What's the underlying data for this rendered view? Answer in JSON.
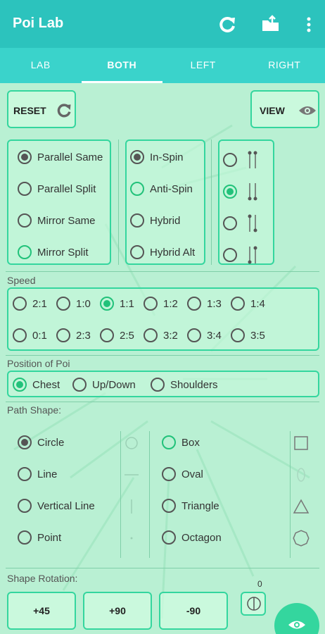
{
  "app": {
    "title": "Poi Lab"
  },
  "toolbar_icons": [
    "refresh-icon",
    "open-folder-icon",
    "more-vert-icon"
  ],
  "tabs": [
    {
      "label": "LAB",
      "active": false
    },
    {
      "label": "BOTH",
      "active": true
    },
    {
      "label": "LEFT",
      "active": false
    },
    {
      "label": "RIGHT",
      "active": false
    }
  ],
  "buttons": {
    "reset": "RESET",
    "view": "VIEW"
  },
  "hand_mode": {
    "options": [
      "Parallel Same",
      "Parallel Split",
      "Mirror Same",
      "Mirror Split"
    ],
    "selected": "Parallel Same"
  },
  "spin_mode": {
    "options": [
      "In-Spin",
      "Anti-Spin",
      "Hybrid",
      "Hybrid Alt"
    ],
    "selected": "In-Spin"
  },
  "orientation": {
    "selected_index": 1
  },
  "speed": {
    "label": "Speed",
    "row1": [
      "2:1",
      "1:0",
      "1:1",
      "1:2",
      "1:3",
      "1:4"
    ],
    "row2": [
      "0:1",
      "2:3",
      "2:5",
      "3:2",
      "3:4",
      "3:5"
    ],
    "selected": "1:1"
  },
  "position": {
    "label": "Position of Poi",
    "options": [
      "Chest",
      "Up/Down",
      "Shoulders"
    ],
    "selected": "Chest"
  },
  "path_shape": {
    "label": "Path Shape:",
    "left": [
      "Circle",
      "Line",
      "Vertical Line",
      "Point"
    ],
    "right": [
      "Box",
      "Oval",
      "Triangle",
      "Octagon"
    ],
    "selected": "Circle"
  },
  "rotation": {
    "label": "Shape Rotation:",
    "buttons": [
      "+45",
      "+90",
      "-90"
    ],
    "value": "0"
  },
  "colors": {
    "accent": "#2cc3bd",
    "tab_bar": "#3ad3cb",
    "border": "#34d69e",
    "background": "#b9f0d3"
  }
}
